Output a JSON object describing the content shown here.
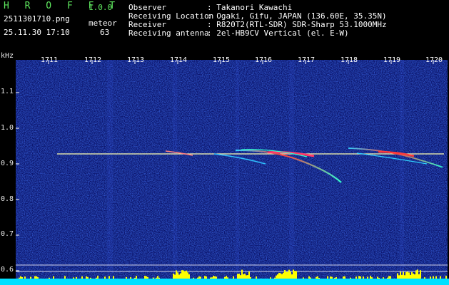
{
  "app": {
    "name": "H R O F F T",
    "version": "1.0.0"
  },
  "file": {
    "name": "2511301710.png",
    "datetime": "25.11.30 17:10"
  },
  "detection": {
    "label": "meteor",
    "count": "63"
  },
  "info": [
    {
      "label": "Observer",
      "value": ": Takanori Kawachi"
    },
    {
      "label": "Receiving Location",
      "value": ": Ogaki, Gifu, JAPAN (136.60E, 35.35N)"
    },
    {
      "label": "Receiver",
      "value": ": R820T2(RTL-SDR) SDR-Sharp 53.1000MHz"
    },
    {
      "label": "Receiving antenna",
      "value": ": 2el-HB9CV Vertical (el. E-W)"
    }
  ],
  "spectrogram": {
    "y_unit": "kHz",
    "y_ticks": [
      "1.1",
      "1.0",
      "0.9",
      "0.8",
      "0.7",
      "0.6"
    ],
    "x_ticks": [
      "1711",
      "1712",
      "1713",
      "1714",
      "1715",
      "1716",
      "1717",
      "1718",
      "1719",
      "1720"
    ],
    "colors": {
      "background": "#0a1470",
      "carrier": "#ffffb0",
      "echo_hot": "#ff3030",
      "level_bars": "#ffff00",
      "baseline": "#00e0ff"
    }
  }
}
